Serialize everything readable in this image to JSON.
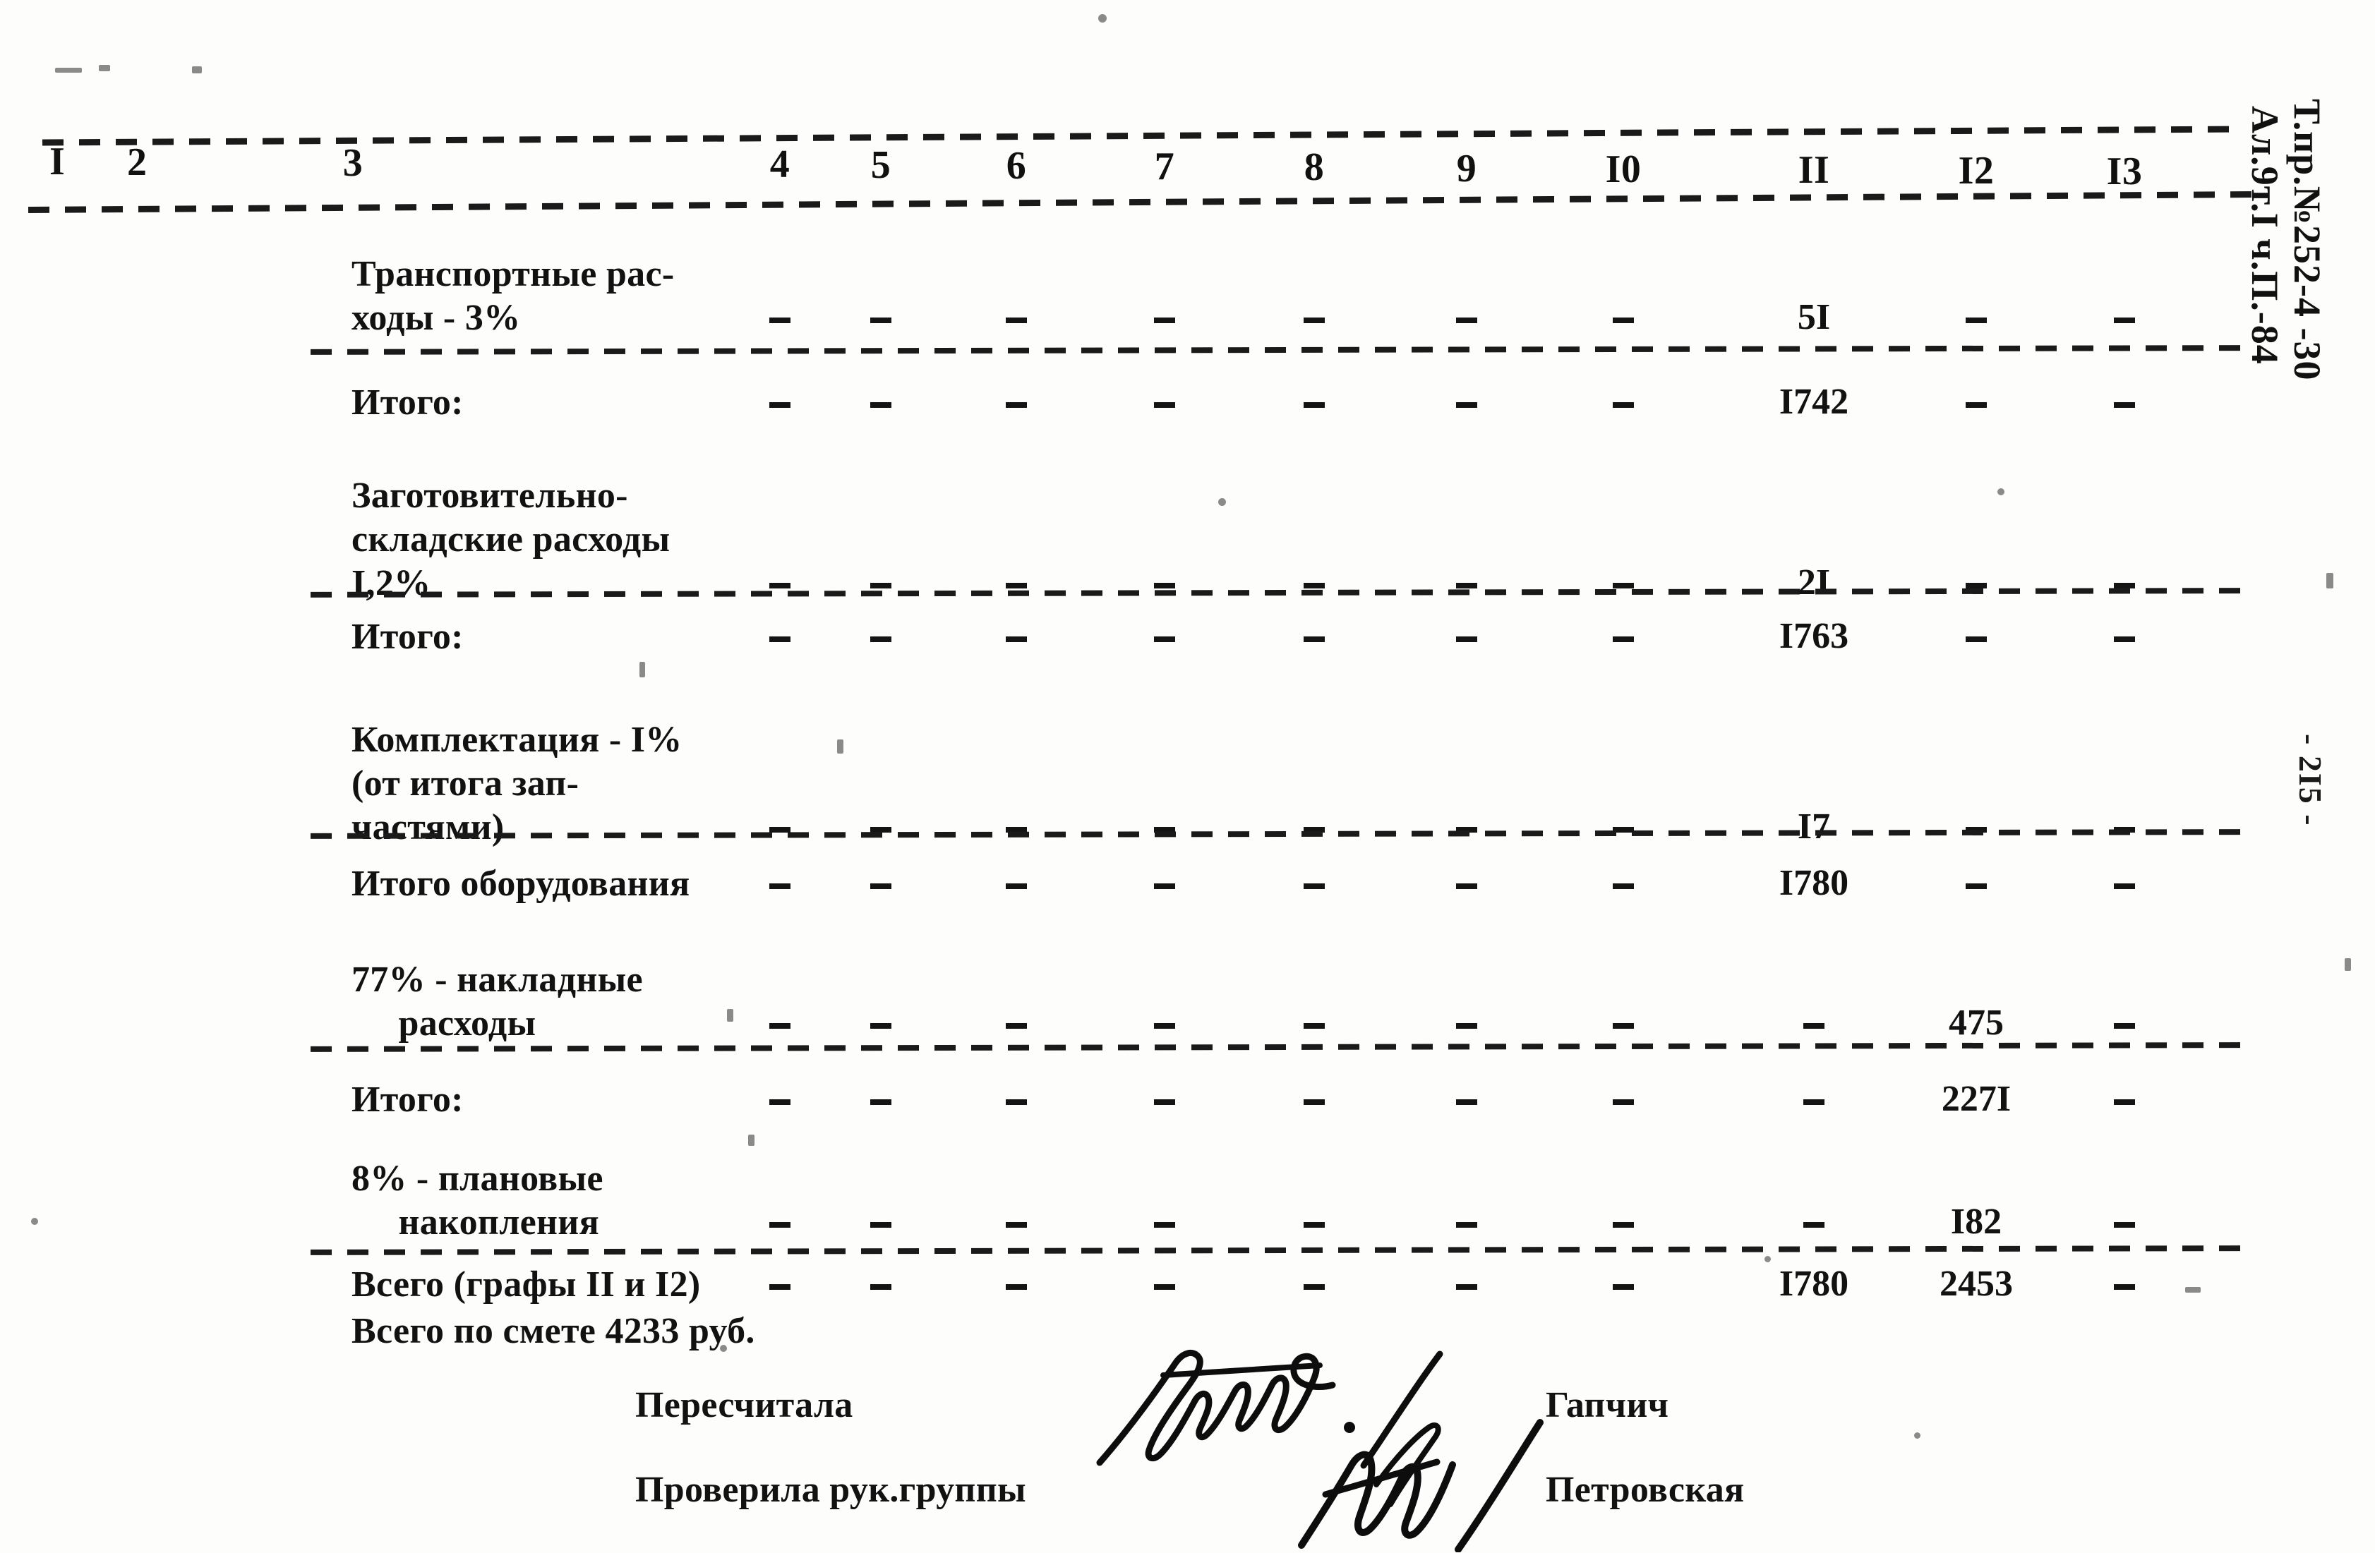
{
  "document": {
    "kind": "soviet-construction-estimate-sheet",
    "page_number": "- 2I5 -",
    "margin_stamp_line1": "Т.пр.№252-4 -30",
    "margin_stamp_line2": "Ал.9т.I ч.П.-84"
  },
  "table": {
    "column_headers": [
      "I",
      "2",
      "3",
      "4",
      "5",
      "6",
      "7",
      "8",
      "9",
      "I0",
      "II",
      "I2",
      "I3"
    ],
    "rows": [
      {
        "label": "Транспортные рас-\nходы - 3%",
        "label_lines": [
          "Транспортные рас-",
          "ходы - 3%"
        ],
        "cells": [
          "",
          "",
          "",
          "–",
          "–",
          "–",
          "–",
          "–",
          "–",
          "–",
          "5I",
          "–",
          "–"
        ],
        "rule_below": true
      },
      {
        "label": "Итого:",
        "label_lines": [
          "Итого:"
        ],
        "cells": [
          "",
          "",
          "",
          "–",
          "–",
          "–",
          "–",
          "–",
          "–",
          "–",
          "I742",
          "–",
          "–"
        ],
        "rule_below": false
      },
      {
        "label": "Заготовительно-\nскладские расходы\nI,2%",
        "label_lines": [
          "Заготовительно-",
          "складские расходы",
          "I,2%"
        ],
        "cells": [
          "",
          "",
          "",
          "–",
          "–",
          "–",
          "–",
          "–",
          "–",
          "–",
          "2I",
          "–",
          "–"
        ],
        "rule_below": true
      },
      {
        "label": "Итого:",
        "label_lines": [
          "Итого:"
        ],
        "cells": [
          "",
          "",
          "",
          "–",
          "–",
          "–",
          "–",
          "–",
          "–",
          "–",
          "I763",
          "–",
          "–"
        ],
        "rule_below": false
      },
      {
        "label": "Комплектация - I%\n(от итога зап-\nчастями)",
        "label_lines": [
          "Комплектация - I%",
          "(от итога зап-",
          "частями)"
        ],
        "cells": [
          "",
          "",
          "",
          "–",
          "–",
          "–",
          "–",
          "–",
          "–",
          "–",
          "I7",
          "–",
          "–"
        ],
        "rule_below": true
      },
      {
        "label": "Итого оборудования",
        "label_lines": [
          "Итого оборудования"
        ],
        "cells": [
          "",
          "",
          "",
          "–",
          "–",
          "–",
          "–",
          "–",
          "–",
          "–",
          "I780",
          "–",
          "–"
        ],
        "rule_below": false
      },
      {
        "label": "77% - накладные\n     расходы",
        "label_lines": [
          "77% - накладные",
          "     расходы"
        ],
        "cells": [
          "",
          "",
          "",
          "–",
          "–",
          "–",
          "–",
          "–",
          "–",
          "–",
          "–",
          "475",
          "–"
        ],
        "rule_below": true
      },
      {
        "label": "Итого:",
        "label_lines": [
          "Итого:"
        ],
        "cells": [
          "",
          "",
          "",
          "–",
          "–",
          "–",
          "–",
          "–",
          "–",
          "–",
          "–",
          "227I",
          "–"
        ],
        "rule_below": false
      },
      {
        "label": "8% - плановые\n     накопления",
        "label_lines": [
          "8% - плановые",
          "     накопления"
        ],
        "cells": [
          "",
          "",
          "",
          "–",
          "–",
          "–",
          "–",
          "–",
          "–",
          "–",
          "–",
          "I82",
          "–"
        ],
        "rule_below": true
      },
      {
        "label": "Всего (графы II и I2)",
        "label_lines": [
          "Всего (графы II и I2)"
        ],
        "cells": [
          "",
          "",
          "",
          "–",
          "–",
          "–",
          "–",
          "–",
          "–",
          "–",
          "I780",
          "2453",
          "–"
        ],
        "rule_below": false
      }
    ]
  },
  "footer": {
    "total_line": "Всего по смете 4233 руб.",
    "signatures": [
      {
        "role": "Пересчитала",
        "name": "Гапчич"
      },
      {
        "role": "Проверила рук.группы",
        "name": "Петровская"
      }
    ]
  }
}
